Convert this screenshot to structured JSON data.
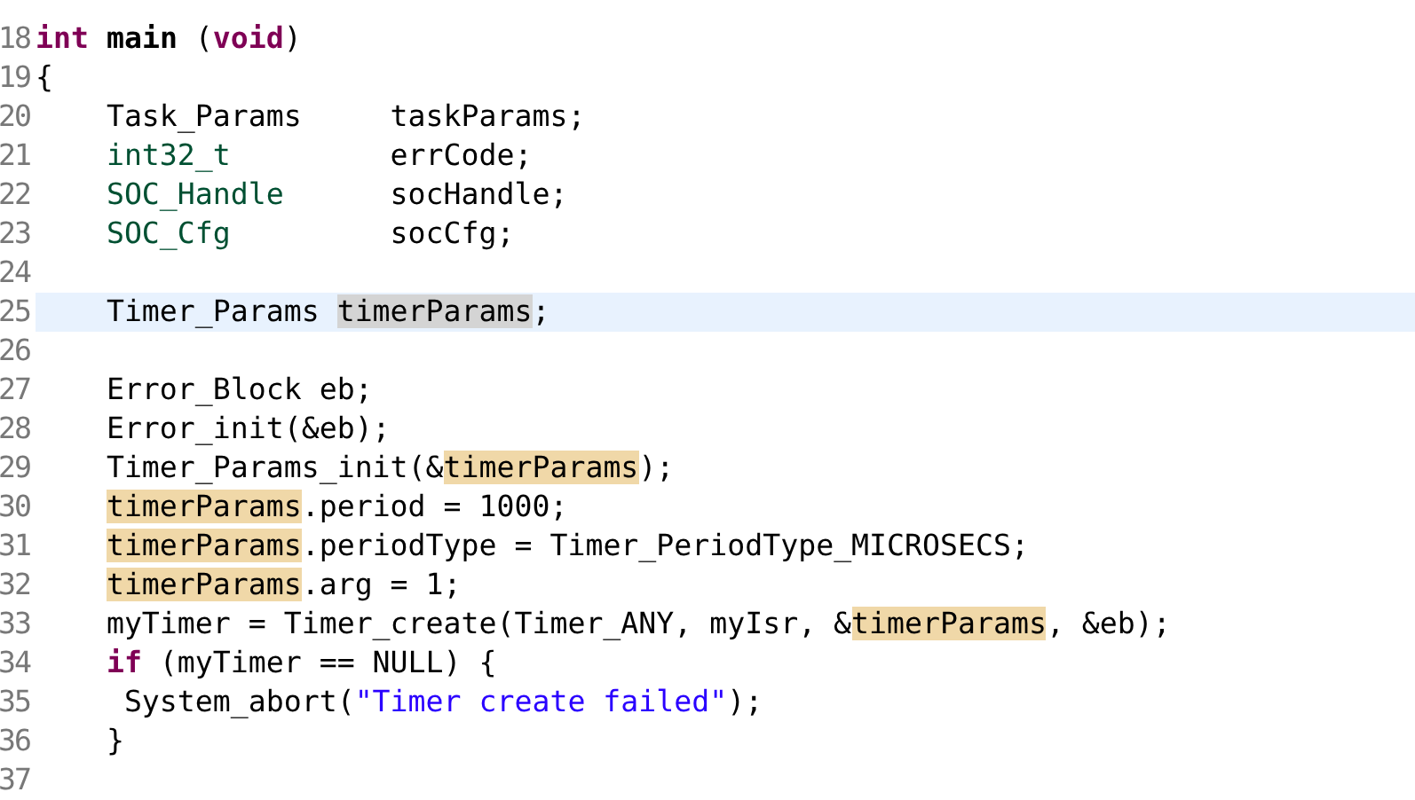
{
  "editor": {
    "lines": [
      {
        "number": "18",
        "current": false,
        "tokens": [
          {
            "text": "int",
            "kind": "keyword"
          },
          {
            "text": " main",
            "kind": "bold"
          },
          {
            "text": " (",
            "kind": "plain"
          },
          {
            "text": "void",
            "kind": "keyword"
          },
          {
            "text": ")",
            "kind": "plain"
          }
        ]
      },
      {
        "number": "19",
        "current": false,
        "tokens": [
          {
            "text": "{",
            "kind": "plain"
          }
        ]
      },
      {
        "number": "20",
        "current": false,
        "kind": "block",
        "tokens": [
          {
            "text": "Task_Params     taskParams;",
            "kind": "plain"
          }
        ]
      },
      {
        "number": "21",
        "current": false,
        "kind": "block",
        "tokens": [
          {
            "text": "int32_t",
            "kind": "type"
          },
          {
            "text": "         errCode;",
            "kind": "plain"
          }
        ]
      },
      {
        "number": "22",
        "current": false,
        "kind": "block",
        "tokens": [
          {
            "text": "SOC_Handle",
            "kind": "type"
          },
          {
            "text": "      socHandle;",
            "kind": "plain"
          }
        ]
      },
      {
        "number": "23",
        "current": false,
        "kind": "block",
        "tokens": [
          {
            "text": "SOC_Cfg",
            "kind": "type"
          },
          {
            "text": "         socCfg;",
            "kind": "plain"
          }
        ]
      },
      {
        "number": "24",
        "current": false
      },
      {
        "number": "25",
        "current": true,
        "kind": "block",
        "tokens": [
          {
            "text": "Timer_Params ",
            "kind": "plain"
          },
          {
            "text": "timerParams",
            "kind": "selected"
          },
          {
            "text": ";",
            "kind": "plain"
          }
        ]
      },
      {
        "number": "26",
        "current": false
      },
      {
        "number": "27",
        "current": false,
        "kind": "block",
        "tokens": [
          {
            "text": "Error_Block eb;",
            "kind": "plain"
          }
        ]
      },
      {
        "number": "28",
        "current": false,
        "kind": "block",
        "tokens": [
          {
            "text": "Error_init(&eb);",
            "kind": "plain"
          }
        ]
      },
      {
        "number": "29",
        "current": false,
        "kind": "block",
        "tokens": [
          {
            "text": "Timer_Params_init(&",
            "kind": "plain"
          },
          {
            "text": "timerParams",
            "kind": "occurrence"
          },
          {
            "text": ");",
            "kind": "plain"
          }
        ]
      },
      {
        "number": "30",
        "current": false,
        "kind": "block",
        "tokens": [
          {
            "text": "timerParams",
            "kind": "occurrence"
          },
          {
            "text": ".period = 1000;",
            "kind": "plain"
          }
        ]
      },
      {
        "number": "31",
        "current": false,
        "kind": "block",
        "tokens": [
          {
            "text": "timerParams",
            "kind": "occurrence"
          },
          {
            "text": ".periodType = Timer_PeriodType_MICROSECS;",
            "kind": "plain"
          }
        ]
      },
      {
        "number": "32",
        "current": false,
        "kind": "block",
        "tokens": [
          {
            "text": "timerParams",
            "kind": "occurrence"
          },
          {
            "text": ".arg = 1;",
            "kind": "plain"
          }
        ]
      },
      {
        "number": "33",
        "current": false,
        "kind": "block",
        "tokens": [
          {
            "text": "myTimer = Timer_create(Timer_ANY, myIsr, &",
            "kind": "plain"
          },
          {
            "text": "timerParams",
            "kind": "occurrence"
          },
          {
            "text": ", &eb);",
            "kind": "plain"
          }
        ]
      },
      {
        "number": "34",
        "current": false,
        "kind": "block",
        "tokens": [
          {
            "text": "if",
            "kind": "keyword"
          },
          {
            "text": " (myTimer == NULL) {",
            "kind": "plain"
          }
        ]
      },
      {
        "number": "35",
        "current": false,
        "kind": "deep",
        "tokens": [
          {
            "text": "System_abort(",
            "kind": "plain"
          },
          {
            "text": "\"Timer create failed\"",
            "kind": "string"
          },
          {
            "text": ");",
            "kind": "plain"
          }
        ]
      },
      {
        "number": "36",
        "current": false,
        "kind": "block",
        "tokens": [
          {
            "text": "}",
            "kind": "plain"
          }
        ]
      },
      {
        "number": "37",
        "current": false
      }
    ]
  }
}
